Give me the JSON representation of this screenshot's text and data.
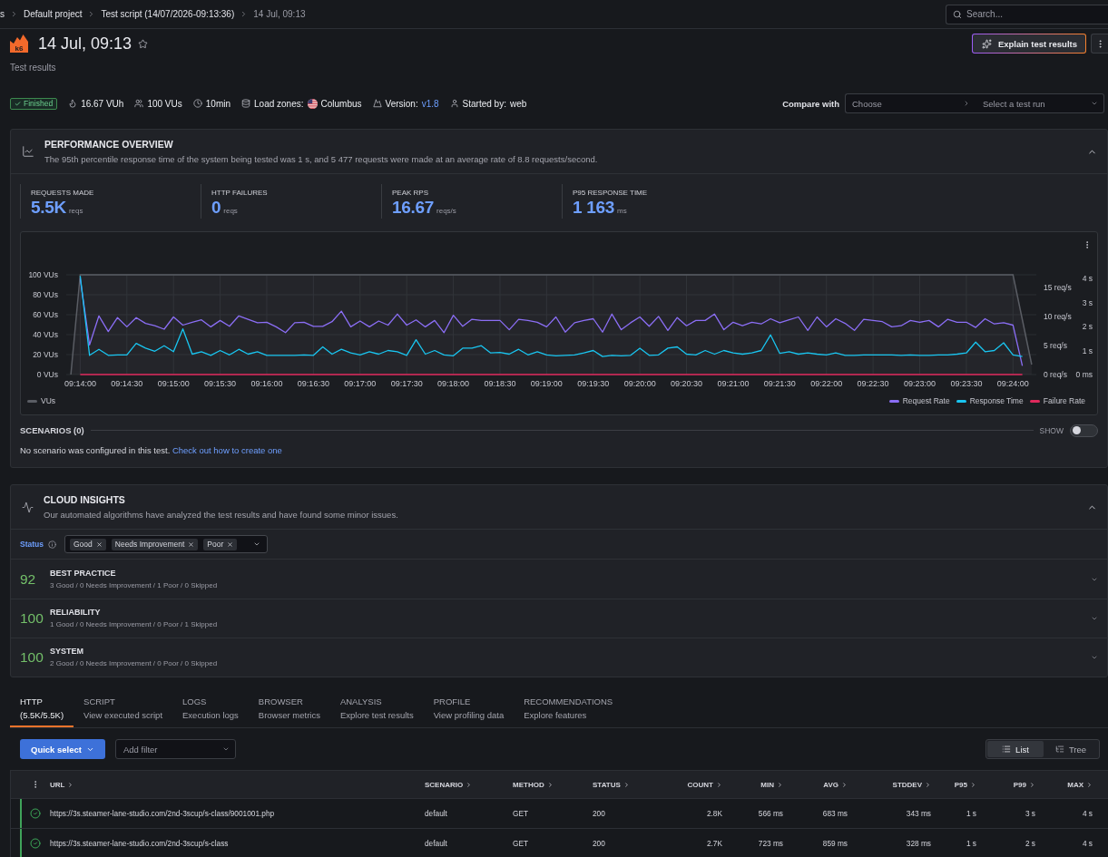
{
  "breadcrumb": [
    {
      "label": "s",
      "current": false
    },
    {
      "label": "Default project",
      "current": false
    },
    {
      "label": "Test script (14/07/2026-09:13:36)",
      "current": false
    },
    {
      "label": "14 Jul, 09:13",
      "current": true
    }
  ],
  "search": {
    "placeholder": "Search..."
  },
  "header": {
    "logo": "k6",
    "title": "14 Jul, 09:13",
    "starred": false,
    "subtitle": "Test results",
    "explain_button": "Explain test results"
  },
  "meta": {
    "status": {
      "label": "Finished",
      "kind": "success"
    },
    "items": [
      {
        "kind": "vuh",
        "label": "16.67 VUh"
      },
      {
        "kind": "vus",
        "label": "100 VUs"
      },
      {
        "kind": "duration",
        "label": "10min"
      },
      {
        "kind": "zones",
        "label": "Load zones:",
        "value": "Columbus"
      },
      {
        "kind": "version",
        "label": "Version:",
        "value": "v1.8"
      },
      {
        "kind": "started",
        "label": "Started by:",
        "value": "web"
      }
    ],
    "compare": {
      "label": "Compare with",
      "first": {
        "placeholder": "Choose"
      },
      "second": {
        "placeholder": "Select a test run"
      }
    }
  },
  "performance": {
    "title": "PERFORMANCE OVERVIEW",
    "description": "The 95th percentile response time of the system being tested was 1 s, and 5 477 requests were made at an average rate of 8.8 requests/second.",
    "expanded": true,
    "stats": [
      {
        "label": "REQUESTS MADE",
        "value": "5.5K",
        "unit": "reqs"
      },
      {
        "label": "HTTP FAILURES",
        "value": "0",
        "unit": "reqs"
      },
      {
        "label": "PEAK RPS",
        "value": "16.67",
        "unit": "reqs/s"
      },
      {
        "label": "P95 RESPONSE TIME",
        "value": "1 163",
        "unit": "ms"
      }
    ],
    "chart_data": {
      "type": "line",
      "grid": true,
      "legend": true,
      "ylim": [
        0,
        100
      ],
      "y2lim": [
        0,
        17.16
      ],
      "y3lim": [
        0,
        4.154
      ],
      "categories": [
        null,
        "09:14:00",
        null,
        null,
        null,
        null,
        "09:14:30",
        null,
        null,
        null,
        null,
        "09:15:00",
        null,
        null,
        null,
        null,
        "09:15:30",
        null,
        null,
        null,
        null,
        "09:16:00",
        null,
        null,
        null,
        null,
        "09:16:30",
        null,
        null,
        null,
        null,
        "09:17:00",
        null,
        null,
        null,
        null,
        "09:17:30",
        null,
        null,
        null,
        null,
        "09:18:00",
        null,
        null,
        null,
        null,
        "09:18:30",
        null,
        null,
        null,
        null,
        "09:19:00",
        null,
        null,
        null,
        null,
        "09:19:30",
        null,
        null,
        null,
        null,
        "09:20:00",
        null,
        null,
        null,
        null,
        "09:20:30",
        null,
        null,
        null,
        null,
        "09:21:00",
        null,
        null,
        null,
        null,
        "09:21:30",
        null,
        null,
        null,
        null,
        "09:22:00",
        null,
        null,
        null,
        null,
        "09:22:30",
        null,
        null,
        null,
        null,
        "09:23:00",
        null,
        null,
        null,
        null,
        "09:23:30",
        null,
        null,
        null,
        null,
        "09:24:00",
        null,
        null
      ],
      "yticks": [
        {
          "value": 0,
          "label": "0 VUs"
        },
        {
          "value": 20,
          "label": "20 VUs"
        },
        {
          "value": 40,
          "label": "40 VUs"
        },
        {
          "value": 60,
          "label": "60 VUs"
        },
        {
          "value": 80,
          "label": "80 VUs"
        },
        {
          "value": 100,
          "label": "100 VUs"
        }
      ],
      "y2ticks": [
        {
          "value": 0,
          "label": "0 req/s"
        },
        {
          "value": 5,
          "label": "5 req/s"
        },
        {
          "value": 10,
          "label": "10 req/s"
        },
        {
          "value": 15,
          "label": "15 req/s"
        }
      ],
      "y3ticks": [
        {
          "value": 0,
          "label": "0 ms"
        },
        {
          "value": 1,
          "label": "1 s"
        },
        {
          "value": 2,
          "label": "2 s"
        },
        {
          "value": 3,
          "label": "3 s"
        },
        {
          "value": 4,
          "label": "4 s"
        }
      ],
      "series": [
        {
          "name": "VUs",
          "color": "#5a5d64",
          "axis": "y",
          "values": [
            0,
            100,
            100,
            100,
            100,
            100,
            100,
            100,
            100,
            100,
            100,
            100,
            100,
            100,
            100,
            100,
            100,
            100,
            100,
            100,
            100,
            100,
            100,
            100,
            100,
            100,
            100,
            100,
            100,
            100,
            100,
            100,
            100,
            100,
            100,
            100,
            100,
            100,
            100,
            100,
            100,
            100,
            100,
            100,
            100,
            100,
            100,
            100,
            100,
            100,
            100,
            100,
            100,
            100,
            100,
            100,
            100,
            100,
            100,
            100,
            100,
            100,
            100,
            100,
            100,
            100,
            100,
            100,
            100,
            100,
            100,
            100,
            100,
            100,
            100,
            100,
            100,
            100,
            100,
            100,
            100,
            100,
            100,
            100,
            100,
            100,
            100,
            100,
            100,
            100,
            100,
            100,
            100,
            100,
            100,
            100,
            100,
            100,
            100,
            100,
            100,
            100,
            55,
            10
          ]
        },
        {
          "name": "Request Rate",
          "color": "#8b6ef5",
          "axis": "y2",
          "values": [
            null,
            16.5,
            5.1,
            10.1,
            7.4,
            9.8,
            8.2,
            9.8,
            8.8,
            8.4,
            7.8,
            9.9,
            8.5,
            9.0,
            9.4,
            8.2,
            9.3,
            8.3,
            10.1,
            9.5,
            8.9,
            9.0,
            8.2,
            7.2,
            8.9,
            9.0,
            8.3,
            8.3,
            9.1,
            10.9,
            8.2,
            9.2,
            8.2,
            9.2,
            8.5,
            10.4,
            8.5,
            9.4,
            8.2,
            9.3,
            7.2,
            10.2,
            8.3,
            9.5,
            9.3,
            9.3,
            9.3,
            7.7,
            9.5,
            9.3,
            9.0,
            8.2,
            9.9,
            7.3,
            8.9,
            9.3,
            9.6,
            7.3,
            10.4,
            7.7,
            8.9,
            9.9,
            8.3,
            10.0,
            7.6,
            9.8,
            8.4,
            9.3,
            9.3,
            10.4,
            7.7,
            9.0,
            8.4,
            9.0,
            8.7,
            9.6,
            8.9,
            9.4,
            9.9,
            7.6,
            9.9,
            8.2,
            9.6,
            8.8,
            7.6,
            9.5,
            9.3,
            9.1,
            8.2,
            8.4,
            9.3,
            9.0,
            9.3,
            8.2,
            9.5,
            9.0,
            9.0,
            8.1,
            9.6,
            8.7,
            8.9,
            8.5,
            1.5,
            null
          ]
        },
        {
          "name": "Response Time",
          "color": "#19c5f0",
          "axis": "y3",
          "values": [
            null,
            4.1,
            0.8,
            1.05,
            0.8,
            0.82,
            0.82,
            1.3,
            1.1,
            0.97,
            1.2,
            0.95,
            1.9,
            0.85,
            0.95,
            0.8,
            1.0,
            0.82,
            1.05,
            0.85,
            0.95,
            0.8,
            0.8,
            0.8,
            0.8,
            0.82,
            0.8,
            1.15,
            0.85,
            1.05,
            0.9,
            0.82,
            0.95,
            0.85,
            1.0,
            0.95,
            0.8,
            1.45,
            0.85,
            1.0,
            0.82,
            0.78,
            1.1,
            1.1,
            1.2,
            0.9,
            0.92,
            0.85,
            1.05,
            0.82,
            0.95,
            0.82,
            0.78,
            0.8,
            0.82,
            0.9,
            1.0,
            0.75,
            0.8,
            0.78,
            0.8,
            1.1,
            0.8,
            0.82,
            1.1,
            1.15,
            0.85,
            0.82,
            1.0,
            0.85,
            1.0,
            0.9,
            0.85,
            0.9,
            1.0,
            1.65,
            0.88,
            0.95,
            0.85,
            0.9,
            0.85,
            0.82,
            0.9,
            0.8,
            0.8,
            0.82,
            0.82,
            0.82,
            0.82,
            0.8,
            0.82,
            0.8,
            0.8,
            0.82,
            0.82,
            0.85,
            0.9,
            1.35,
            0.95,
            1.0,
            1.32,
            0.82,
            0.75,
            null
          ]
        },
        {
          "name": "Failure Rate",
          "color": "#e0295c",
          "axis": "y2",
          "values": [
            null,
            0,
            0,
            0,
            0,
            0,
            0,
            0,
            0,
            0,
            0,
            0,
            0,
            0,
            0,
            0,
            0,
            0,
            0,
            0,
            0,
            0,
            0,
            0,
            0,
            0,
            0,
            0,
            0,
            0,
            0,
            0,
            0,
            0,
            0,
            0,
            0,
            0,
            0,
            0,
            0,
            0,
            0,
            0,
            0,
            0,
            0,
            0,
            0,
            0,
            0,
            0,
            0,
            0,
            0,
            0,
            0,
            0,
            0,
            0,
            0,
            0,
            0,
            0,
            0,
            0,
            0,
            0,
            0,
            0,
            0,
            0,
            0,
            0,
            0,
            0,
            0,
            0,
            0,
            0,
            0,
            0,
            0,
            0,
            0,
            0,
            0,
            0,
            0,
            0,
            0,
            0,
            0,
            0,
            0,
            0,
            0,
            0,
            0,
            0,
            0,
            0,
            0,
            null
          ]
        }
      ]
    },
    "scenarios": {
      "label": "SCENARIOS (0)",
      "toggle_label": "SHOW",
      "on": false
    },
    "note": {
      "text": "No scenario was configured in this test.",
      "link": "Check out how to create one"
    }
  },
  "insights": {
    "title": "CLOUD INSIGHTS",
    "description": "Our automated algorithms have analyzed the test results and have found some minor issues.",
    "expanded": true,
    "filter": {
      "label": "Status",
      "chips": [
        {
          "label": "Good"
        },
        {
          "label": "Needs Improvement"
        },
        {
          "label": "Poor"
        }
      ]
    },
    "categories": [
      {
        "score": "92",
        "title": "BEST PRACTICE",
        "summary": "3 Good / 0 Needs Improvement / 1 Poor / 0 Skipped",
        "expanded": false
      },
      {
        "score": "100",
        "title": "RELIABILITY",
        "summary": "1 Good / 0 Needs Improvement / 0 Poor / 1 Skipped",
        "expanded": false
      },
      {
        "score": "100",
        "title": "SYSTEM",
        "summary": "2 Good / 0 Needs Improvement / 0 Poor / 0 Skipped",
        "expanded": false
      }
    ]
  },
  "tabs": [
    {
      "label": "HTTP",
      "sublabel": "(5.5K/5.5K)",
      "selected": true
    },
    {
      "label": "SCRIPT",
      "sublabel": "View executed script",
      "selected": false
    },
    {
      "label": "LOGS",
      "sublabel": "Execution logs",
      "selected": false
    },
    {
      "label": "BROWSER",
      "sublabel": "Browser metrics",
      "selected": false
    },
    {
      "label": "ANALYSIS",
      "sublabel": "Explore test results",
      "selected": false
    },
    {
      "label": "PROFILE",
      "sublabel": "View profiling data",
      "selected": false
    },
    {
      "label": "RECOMMENDATIONS",
      "sublabel": "Explore features",
      "selected": false
    }
  ],
  "toolbar": {
    "quick_select": "Quick select",
    "filter": {
      "placeholder": "Add filter"
    },
    "views": [
      {
        "kind": "list",
        "label": "List",
        "selected": true
      },
      {
        "kind": "tree",
        "label": "Tree",
        "selected": false
      }
    ]
  },
  "table": {
    "columns": [
      {
        "label": "URL"
      },
      {
        "label": "SCENARIO"
      },
      {
        "label": "METHOD"
      },
      {
        "label": "STATUS"
      },
      {
        "label": "COUNT"
      },
      {
        "label": "MIN"
      },
      {
        "label": "AVG"
      },
      {
        "label": "STDDEV"
      },
      {
        "label": "P95"
      },
      {
        "label": "P99"
      },
      {
        "label": "MAX"
      }
    ],
    "rows": [
      {
        "passed": true,
        "cells": [
          "https://3s.steamer-lane-studio.com/2nd-3scup/s-class/9001001.php",
          "default",
          "GET",
          "200",
          "2.8K",
          "566 ms",
          "683 ms",
          "343 ms",
          "1 s",
          "3 s",
          "4 s"
        ]
      },
      {
        "passed": true,
        "cells": [
          "https://3s.steamer-lane-studio.com/2nd-3scup/s-class",
          "default",
          "GET",
          "200",
          "2.7K",
          "723 ms",
          "859 ms",
          "328 ms",
          "1 s",
          "2 s",
          "4 s"
        ]
      }
    ]
  }
}
